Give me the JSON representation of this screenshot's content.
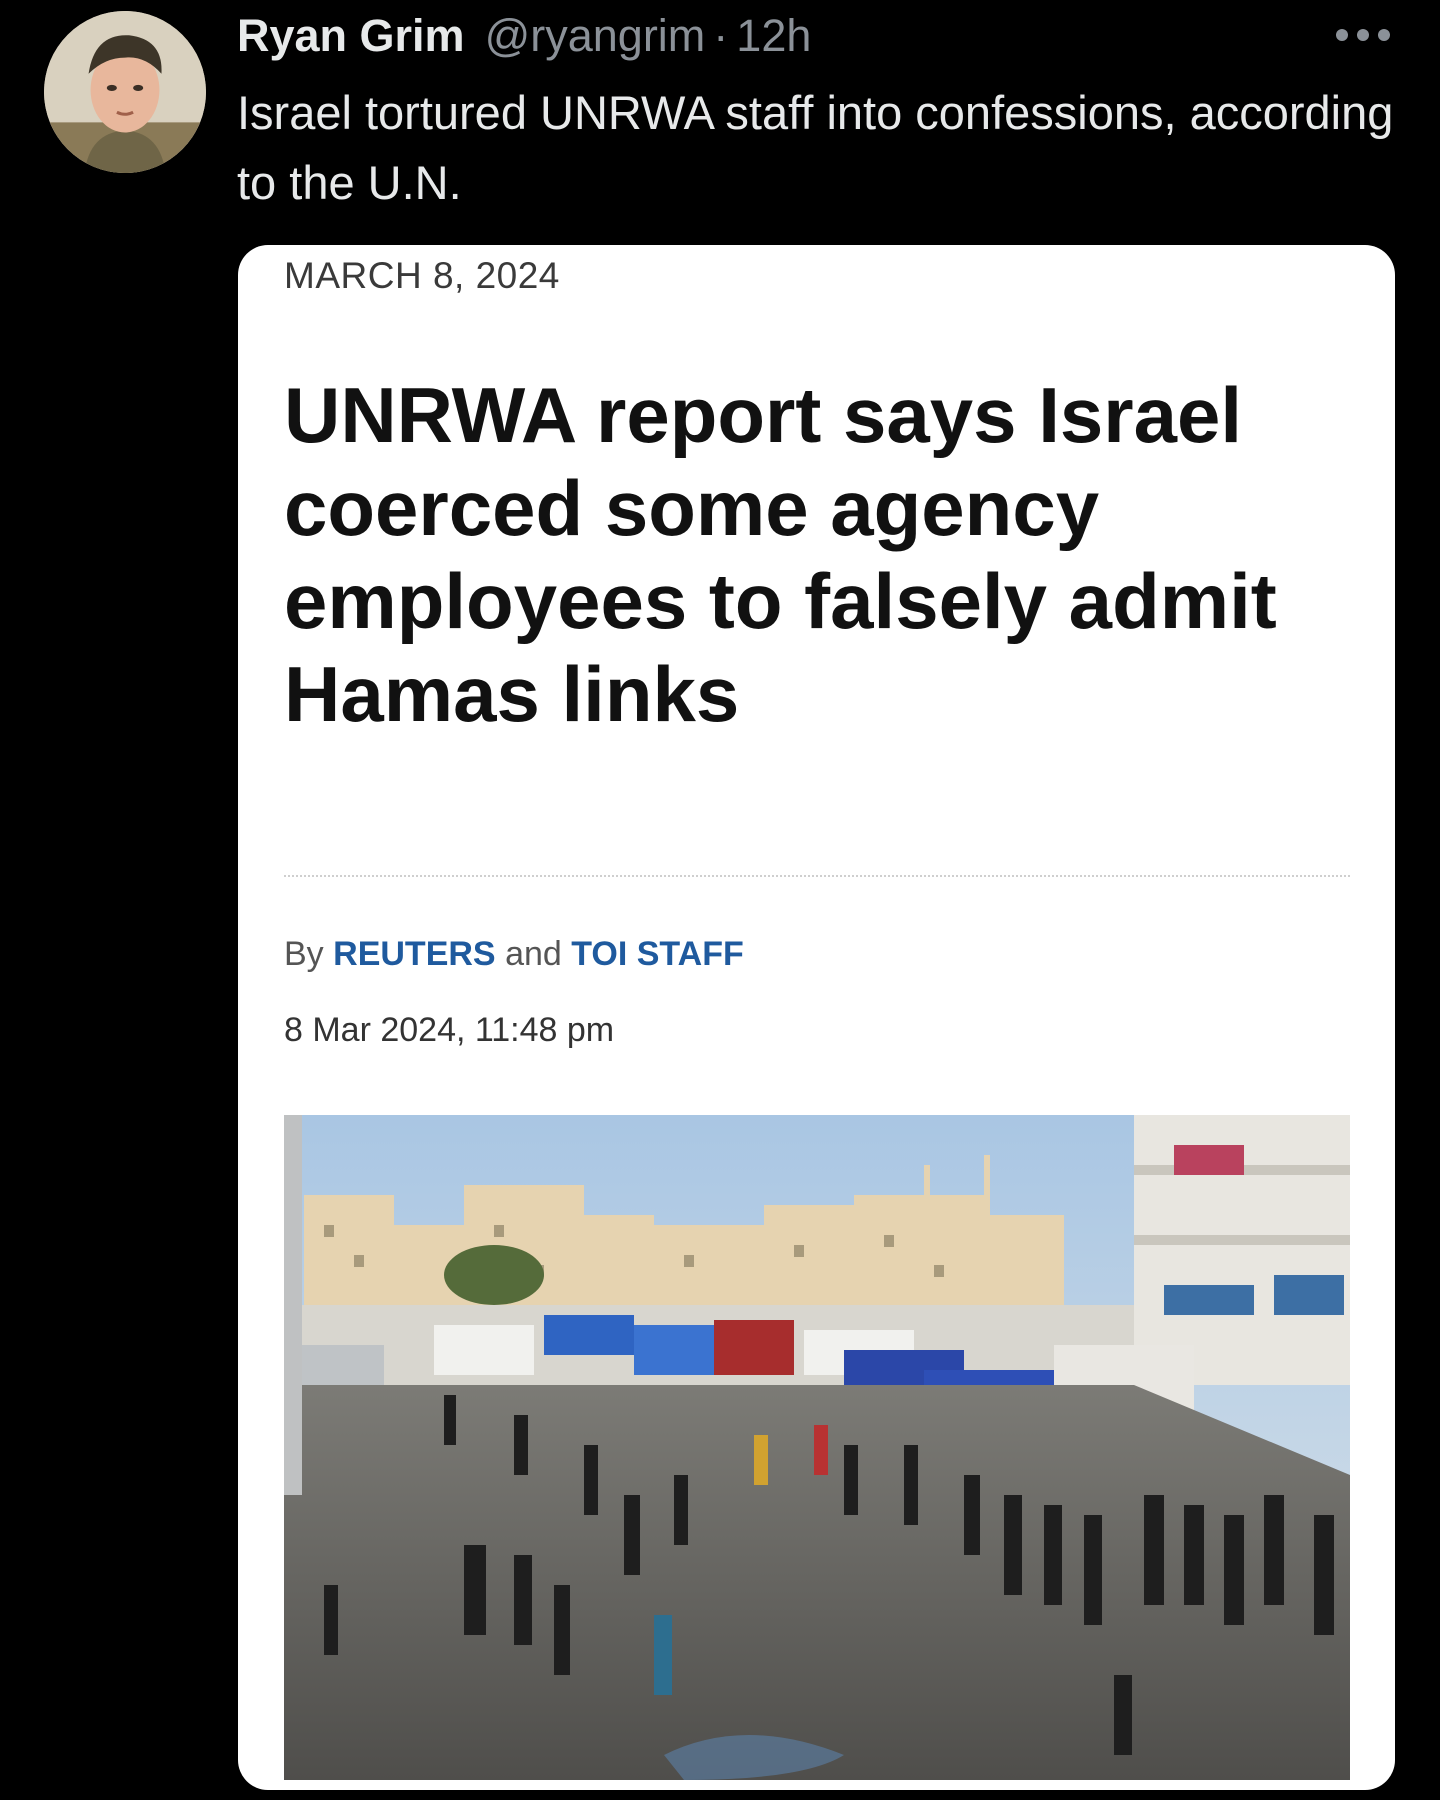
{
  "tweet": {
    "author_name": "Ryan Grim",
    "author_handle": "@ryangrim",
    "separator": "·",
    "timestamp": "12h",
    "more_icon": "more-horizontal-icon",
    "text": "Israel tortured UNRWA staff into confessions, according to the U.N."
  },
  "article": {
    "date": "MARCH 8, 2024",
    "headline": "UNRWA report says Israel coerced some agency employees to falsely admit Hamas links",
    "byline_prefix": "By",
    "authors": [
      "REUTERS",
      "TOI STAFF"
    ],
    "byline_joiner": "and",
    "published": "8 Mar 2024, 11:48 pm"
  },
  "colors": {
    "background": "#000000",
    "tweet_text": "#e7e9ea",
    "secondary_text": "#8b9198",
    "author_link": "#1f5a9e"
  }
}
